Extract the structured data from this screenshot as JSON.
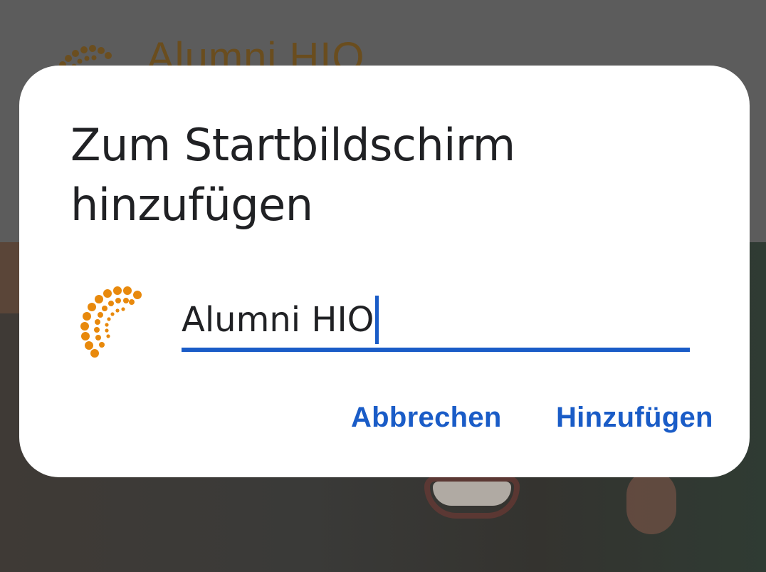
{
  "background_site": {
    "title": "Alumni HIO",
    "logo_icon": "alumni-hio-logo-icon",
    "brand_color": "#e8890c"
  },
  "dialog": {
    "title": "Zum Startbildschirm hinzufügen",
    "app_icon": "alumni-hio-logo-icon",
    "name_value": "Alumni HIO",
    "cancel_label": "Abbrechen",
    "add_label": "Hinzufügen",
    "accent_color": "#1a5cc7"
  }
}
